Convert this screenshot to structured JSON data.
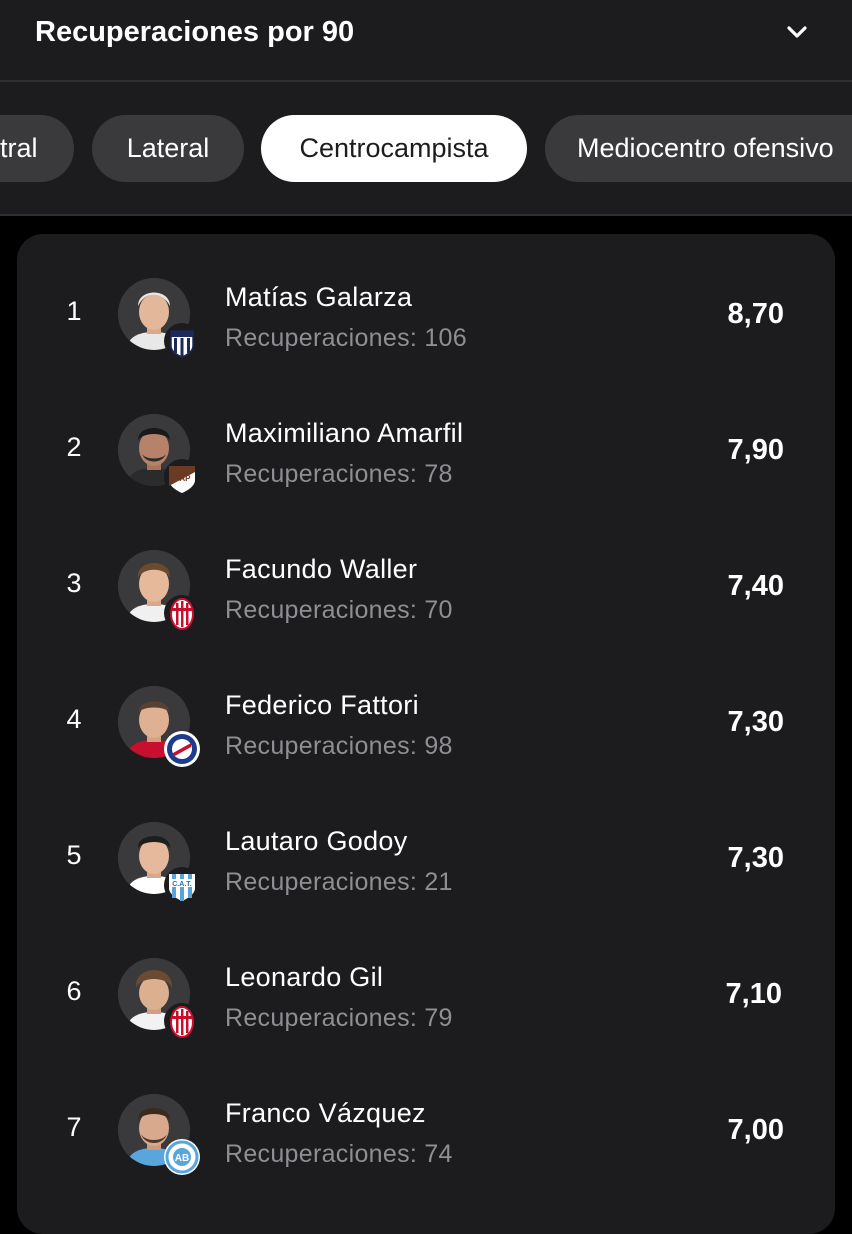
{
  "header": {
    "title": "Recuperaciones por 90"
  },
  "filters": {
    "chips": [
      {
        "label": "Defensor central",
        "visible": "tral"
      },
      {
        "label": "Lateral"
      },
      {
        "label": "Centrocampista",
        "active": true
      },
      {
        "label": "Mediocentro ofensivo"
      }
    ]
  },
  "players": [
    {
      "rank": "1",
      "name": "Matías Galarza",
      "stat": "Recuperaciones: 106",
      "value": "8,70",
      "club_badge": "talleres-badge-icon"
    },
    {
      "rank": "2",
      "name": "Maximiliano Amarfil",
      "stat": "Recuperaciones: 78",
      "value": "7,90",
      "club_badge": "platense-badge-icon"
    },
    {
      "rank": "3",
      "name": "Facundo Waller",
      "stat": "Recuperaciones: 70",
      "value": "7,40",
      "club_badge": "huracan-badge-icon"
    },
    {
      "rank": "4",
      "name": "Federico Fattori",
      "stat": "Recuperaciones: 98",
      "value": "7,30",
      "club_badge": "argentinos-badge-icon"
    },
    {
      "rank": "5",
      "name": "Lautaro Godoy",
      "stat": "Recuperaciones: 21",
      "value": "7,30",
      "club_badge": "atletico-tucuman-badge-icon"
    },
    {
      "rank": "6",
      "name": "Leonardo Gil",
      "stat": "Recuperaciones: 79",
      "value": "7,10",
      "club_badge": "huracan-badge-icon"
    },
    {
      "rank": "7",
      "name": "Franco Vázquez",
      "stat": "Recuperaciones: 74",
      "value": "7,00",
      "club_badge": "belgrano-badge-icon"
    }
  ],
  "colors": {
    "background": "#000000",
    "surface": "#1c1c1e",
    "chip": "#3a3a3c",
    "chip_active": "#ffffff",
    "secondary_text": "#8e8e93"
  }
}
